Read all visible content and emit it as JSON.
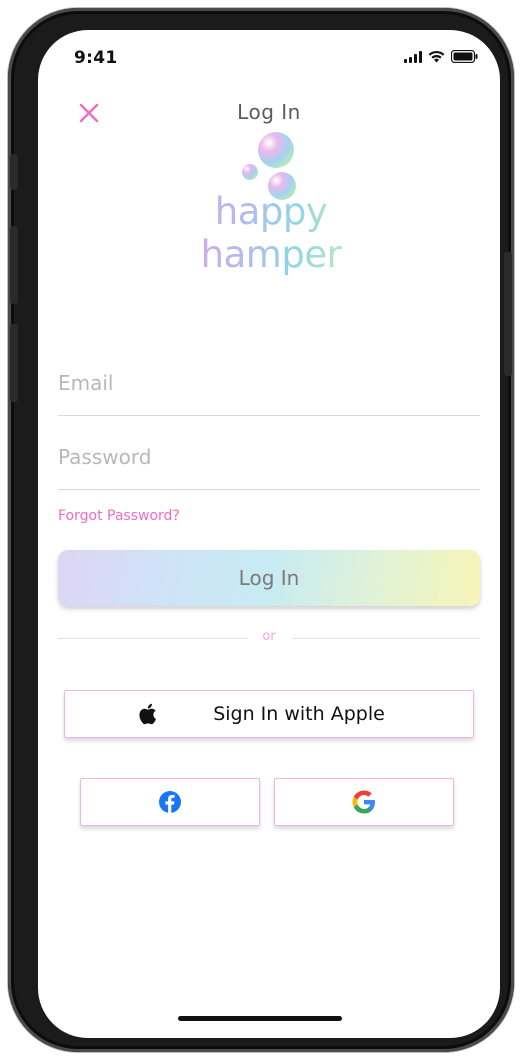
{
  "status": {
    "time": "9:41"
  },
  "header": {
    "title": "Log In"
  },
  "logo": {
    "text": "happy hamper"
  },
  "form": {
    "email_placeholder": "Email",
    "password_placeholder": "Password",
    "forgot_label": "Forgot Password?",
    "login_label": "Log In"
  },
  "divider": {
    "text": "or"
  },
  "social": {
    "apple_label": "Sign In with Apple",
    "icons": [
      "apple-icon",
      "facebook-icon",
      "google-icon"
    ]
  },
  "colors": {
    "accent_pink": "#f06bc6",
    "button_border": "#f2b3e5",
    "facebook_blue": "#1877f2"
  }
}
